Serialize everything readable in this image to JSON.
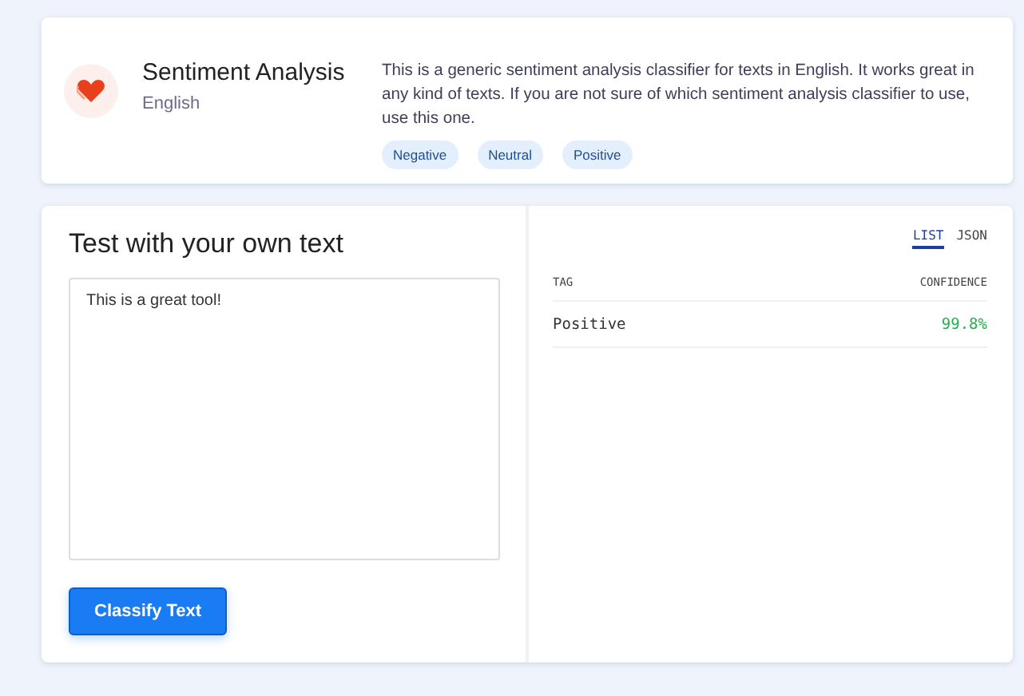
{
  "model": {
    "title": "Sentiment Analysis",
    "language": "English",
    "description": "This is a generic sentiment analysis classifier for texts in English. It works great in any kind of texts. If you are not sure of which sentiment analysis classifier to use, use this one.",
    "tags": [
      "Negative",
      "Neutral",
      "Positive"
    ]
  },
  "test": {
    "heading": "Test with your own text",
    "value": "This is a great tool!",
    "button": "Classify Text"
  },
  "results": {
    "tabs": [
      {
        "label": "LIST",
        "selected": true
      },
      {
        "label": "JSON",
        "selected": false
      }
    ],
    "columns": [
      "TAG",
      "CONFIDENCE"
    ],
    "rows": [
      {
        "tag": "Positive",
        "confidence": "99.8%"
      }
    ]
  }
}
